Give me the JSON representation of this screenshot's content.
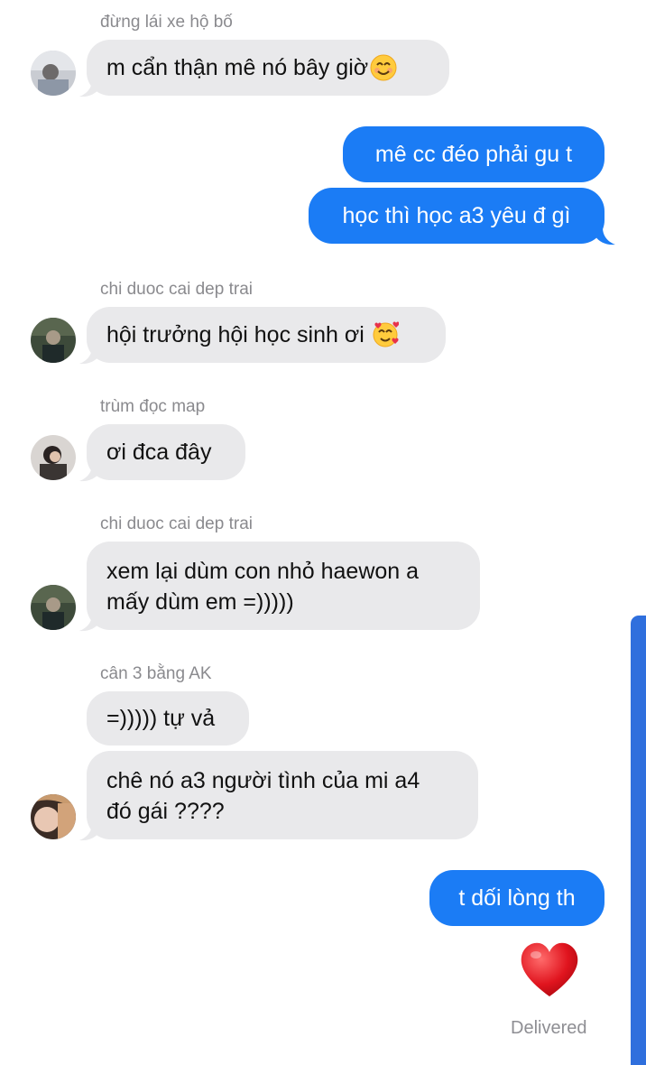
{
  "messages": [
    {
      "sender": "đừng lái xe hộ bố",
      "text": "m cẩn thận mê nó bây giờ",
      "emoji": "smiling-face-icon"
    },
    {
      "text": "mê cc đéo phải gu t"
    },
    {
      "text": "học thì học a3 yêu đ gì"
    },
    {
      "sender": "chi duoc cai dep trai",
      "text": "hội trưởng hội học sinh ơi",
      "emoji": "smiling-face-with-hearts-icon"
    },
    {
      "sender": "trùm đọc map",
      "text": "ơi đca đây"
    },
    {
      "sender": "chi duoc cai dep trai",
      "line1": "xem lại dùm con nhỏ haewon a",
      "line2": "mấy dùm em =)))))"
    },
    {
      "sender": "cân 3 bằng AK",
      "text": "=))))) tự vả"
    },
    {
      "line1": "chê nó a3 người tình của mi a4",
      "line2": "đó gái ????"
    },
    {
      "text": "t dối lòng th"
    }
  ],
  "reaction": "red-heart-icon",
  "status": "Delivered",
  "colors": {
    "outgoing": "#1b7cf5",
    "incoming": "#e9e9eb",
    "scrollbar": "#2f6fdd"
  }
}
